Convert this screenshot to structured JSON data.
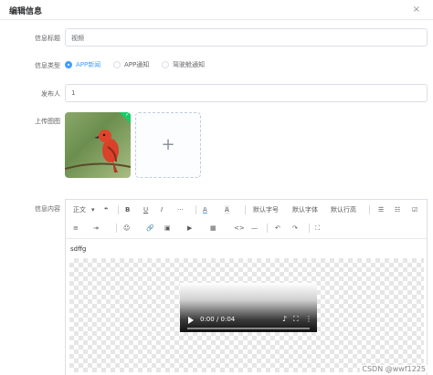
{
  "dialog": {
    "title": "编辑信息",
    "close": "×"
  },
  "form": {
    "title_label": "信息标题",
    "title_value": "视频",
    "type_label": "信息类型",
    "type_options": [
      {
        "label": "APP新闻",
        "checked": true
      },
      {
        "label": "APP通知",
        "checked": false
      },
      {
        "label": "驾驶舱通知",
        "checked": false
      }
    ],
    "publisher_label": "发布人",
    "publisher_value": "1",
    "image_label": "上传图图",
    "content_label": "信息内容"
  },
  "editor": {
    "toolbar_row1": [
      "正文",
      "❝",
      "B",
      "U",
      "I",
      "···",
      "A",
      "A",
      "默认字号",
      "默认字体",
      "默认行高",
      "☰",
      "☷",
      "☑"
    ],
    "toolbar_row2": [
      "≡",
      "⇥",
      "☺",
      "🔗",
      "▣",
      "▶",
      "▦",
      "<>",
      "—",
      "↶",
      "↷",
      "⛶"
    ],
    "content_text": "sdffg",
    "video_time": "0:00 / 0:04"
  },
  "credit": "CSDN @wwf1225"
}
